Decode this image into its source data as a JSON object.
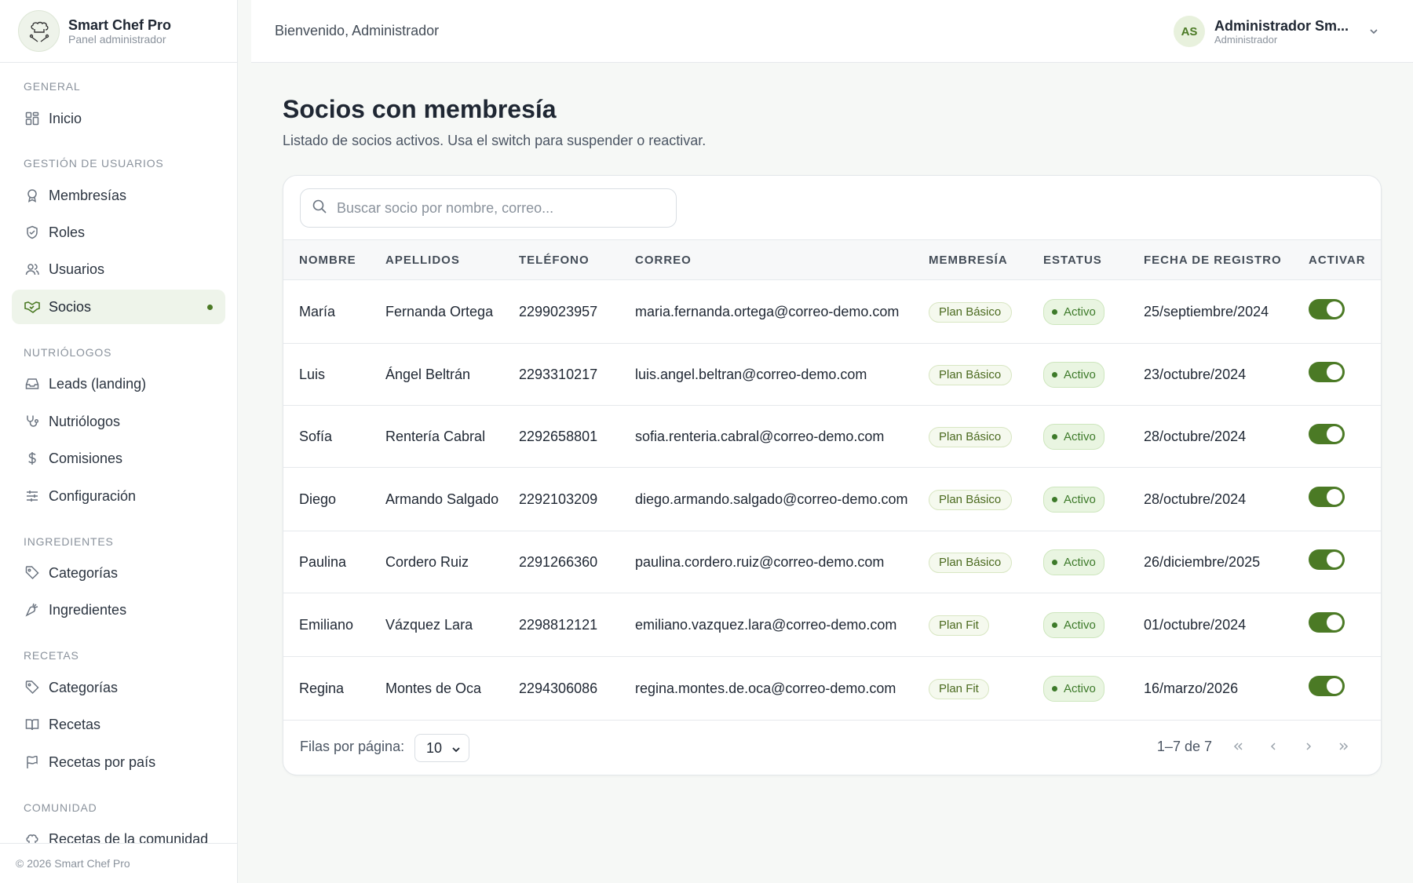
{
  "brand": {
    "title": "Smart Chef Pro",
    "subtitle": "Panel administrador"
  },
  "header": {
    "welcome": "Bienvenido, Administrador",
    "user_initials": "AS",
    "user_name": "Administrador Sm...",
    "user_role": "Administrador"
  },
  "sidebar": {
    "sections": {
      "general": "GENERAL",
      "users": "GESTIÓN DE USUARIOS",
      "nutri": "NUTRIÓLOGOS",
      "ingredients": "INGREDIENTES",
      "recipes": "RECETAS",
      "community": "COMUNIDAD"
    },
    "items": {
      "inicio": "Inicio",
      "membresias": "Membresías",
      "roles": "Roles",
      "usuarios": "Usuarios",
      "socios": "Socios",
      "leads": "Leads (landing)",
      "nutriologos": "Nutriólogos",
      "comisiones": "Comisiones",
      "configuracion": "Configuración",
      "categorias_ing": "Categorías",
      "ingredientes": "Ingredientes",
      "categorias_rec": "Categorías",
      "recetas": "Recetas",
      "recetas_pais": "Recetas por país",
      "recetas_comunidad": "Recetas de la comunidad"
    },
    "footer": "© 2026 Smart Chef Pro"
  },
  "main": {
    "title": "Socios con membresía",
    "subtitle": "Listado de socios activos. Usa el switch para suspender o reactivar.",
    "search_placeholder": "Buscar socio por nombre, correo...",
    "columns": [
      "NOMBRE",
      "APELLIDOS",
      "TELÉFONO",
      "CORREO",
      "MEMBRESÍA",
      "ESTATUS",
      "FECHA DE REGISTRO",
      "ACTIVAR"
    ],
    "rows": [
      {
        "nombre": "María",
        "apellidos": "Fernanda Ortega",
        "telefono": "2299023957",
        "correo": "maria.fernanda.ortega@correo-demo.com",
        "membresia": "Plan Básico",
        "estatus": "Activo",
        "fecha": "25/septiembre/2024",
        "activo": true
      },
      {
        "nombre": "Luis",
        "apellidos": "Ángel Beltrán",
        "telefono": "2293310217",
        "correo": "luis.angel.beltran@correo-demo.com",
        "membresia": "Plan Básico",
        "estatus": "Activo",
        "fecha": "23/octubre/2024",
        "activo": true
      },
      {
        "nombre": "Sofía",
        "apellidos": "Rentería Cabral",
        "telefono": "2292658801",
        "correo": "sofia.renteria.cabral@correo-demo.com",
        "membresia": "Plan Básico",
        "estatus": "Activo",
        "fecha": "28/octubre/2024",
        "activo": true
      },
      {
        "nombre": "Diego",
        "apellidos": "Armando Salgado",
        "telefono": "2292103209",
        "correo": "diego.armando.salgado@correo-demo.com",
        "membresia": "Plan Básico",
        "estatus": "Activo",
        "fecha": "28/octubre/2024",
        "activo": true
      },
      {
        "nombre": "Paulina",
        "apellidos": "Cordero Ruiz",
        "telefono": "2291266360",
        "correo": "paulina.cordero.ruiz@correo-demo.com",
        "membresia": "Plan Básico",
        "estatus": "Activo",
        "fecha": "26/diciembre/2025",
        "activo": true
      },
      {
        "nombre": "Emiliano",
        "apellidos": "Vázquez Lara",
        "telefono": "2298812121",
        "correo": "emiliano.vazquez.lara@correo-demo.com",
        "membresia": "Plan Fit",
        "estatus": "Activo",
        "fecha": "01/octubre/2024",
        "activo": true
      },
      {
        "nombre": "Regina",
        "apellidos": "Montes de Oca",
        "telefono": "2294306086",
        "correo": "regina.montes.de.oca@correo-demo.com",
        "membresia": "Plan Fit",
        "estatus": "Activo",
        "fecha": "16/marzo/2026",
        "activo": true
      }
    ],
    "rows_per_page_label": "Filas por página:",
    "rows_per_page_value": "10",
    "range_text": "1–7 de 7"
  },
  "colors": {
    "accent": "#4b7a25",
    "active_bg": "#eef4ea"
  }
}
